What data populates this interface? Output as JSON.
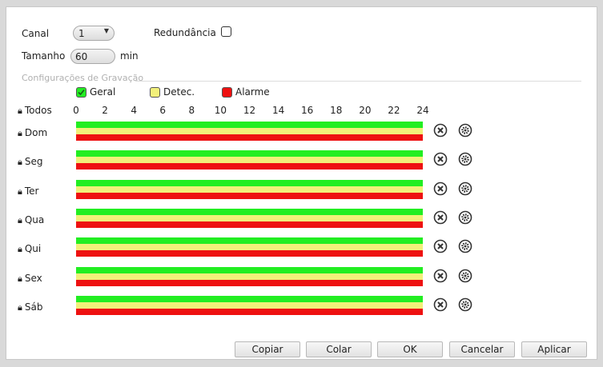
{
  "form": {
    "channel_label": "Canal",
    "channel_value": "1",
    "redundancy_label": "Redundância",
    "size_label": "Tamanho",
    "size_value": "60",
    "size_unit": "min"
  },
  "section_title": "Configurações de Gravação",
  "legend": [
    {
      "label": "Geral",
      "color": "#22ee22",
      "checked": true
    },
    {
      "label": "Detec.",
      "color": "#f2f07a",
      "checked": false
    },
    {
      "label": "Alarme",
      "color": "#ee1111",
      "checked": false
    }
  ],
  "all_label": "Todos",
  "hours": [
    "0",
    "2",
    "4",
    "6",
    "8",
    "10",
    "12",
    "14",
    "16",
    "18",
    "20",
    "22",
    "24"
  ],
  "days": [
    "Dom",
    "Seg",
    "Ter",
    "Qua",
    "Qui",
    "Sex",
    "Sáb"
  ],
  "icons": {
    "lock": "lock-icon",
    "delete": "close-circle-icon",
    "settings": "gear-icon"
  },
  "footer": {
    "copy": "Copiar",
    "paste": "Colar",
    "ok": "OK",
    "cancel": "Cancelar",
    "apply": "Aplicar"
  }
}
